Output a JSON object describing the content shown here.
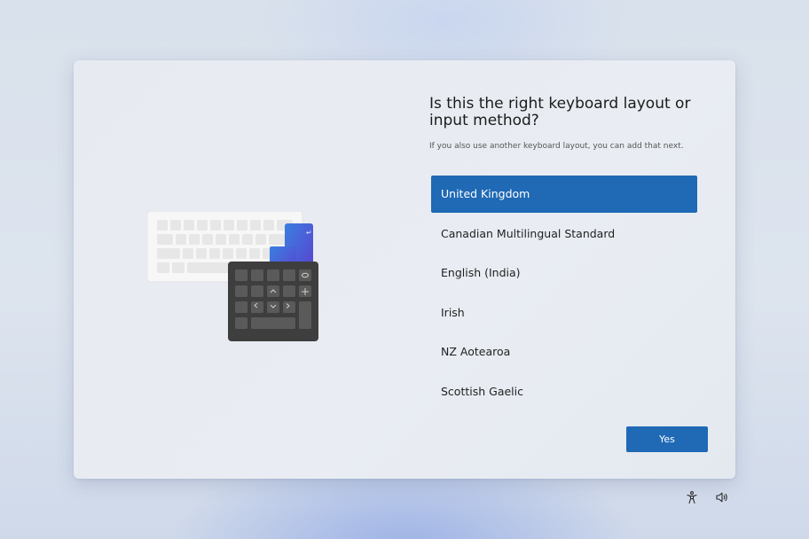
{
  "heading": {
    "title": "Is this the right keyboard layout or input method?",
    "subtitle": "If you also use another keyboard layout, you can add that next."
  },
  "layouts": {
    "selected": "United Kingdom",
    "items": [
      {
        "label": "United Kingdom"
      },
      {
        "label": "Canadian Multilingual Standard"
      },
      {
        "label": "English (India)"
      },
      {
        "label": "Irish"
      },
      {
        "label": "NZ Aotearoa"
      },
      {
        "label": "Scottish Gaelic"
      }
    ]
  },
  "actions": {
    "yes_label": "Yes"
  },
  "tray": {
    "icons": [
      "accessibility-icon",
      "volume-icon"
    ]
  },
  "colors": {
    "accent": "#1f69b5",
    "card_background": "#e8ecf2",
    "desktop_background": "#d9e1ec"
  }
}
